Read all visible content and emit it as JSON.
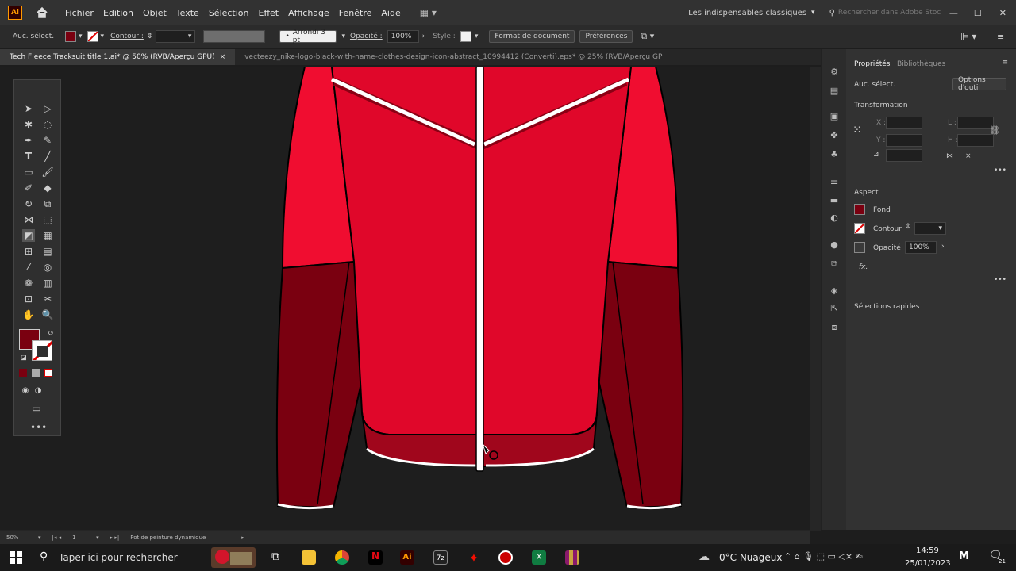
{
  "menubar": {
    "logo": "Ai",
    "items": [
      "Fichier",
      "Edition",
      "Objet",
      "Texte",
      "Sélection",
      "Effet",
      "Affichage",
      "Fenêtre",
      "Aide"
    ],
    "workspace": "Les indispensables classiques",
    "search_placeholder": "Rechercher dans Adobe Stoc"
  },
  "controlbar": {
    "selection": "Auc. sélect.",
    "stroke_label": "Contour :",
    "brush": "Arrondi 3 pt",
    "opacity_label": "Opacité :",
    "opacity_value": "100%",
    "style_label": "Style :",
    "doc_format_button": "Format de document",
    "prefs_button": "Préférences",
    "fill_color": "#7a0010"
  },
  "tabs": [
    {
      "label": "Tech Fleece Tracksuit title 1.ai* @ 50% (RVB/Aperçu GPU)",
      "close": "×"
    },
    {
      "label": "vecteezy_nike-logo-black-with-name-clothes-design-icon-abstract_10994412 (Converti).eps* @ 25% (RVB/Aperçu GP",
      "close": ""
    }
  ],
  "panel": {
    "tab_properties": "Propriétés",
    "tab_libraries": "Bibliothèques",
    "selection": "Auc. sélect.",
    "tool_options_button": "Options d'outil",
    "transform_title": "Transformation",
    "x_label": "X :",
    "y_label": "Y :",
    "w_label": "L :",
    "h_label": "H :",
    "aspect_title": "Aspect",
    "fill_label": "Fond",
    "stroke_label": "Contour",
    "opacity_label": "Opacité",
    "opacity_value": "100%",
    "fx_label": "fx.",
    "quick_actions": "Sélections rapides"
  },
  "statusbar": {
    "zoom": "50%",
    "page": "1",
    "tool": "Pot de peinture dynamique"
  },
  "taskbar": {
    "search_placeholder": "Taper ici pour rechercher",
    "weather": "0°C  Nuageux",
    "time": "14:59",
    "date": "25/01/2023",
    "notif_count": "21"
  },
  "colors": {
    "jacket_main": "#e0072a",
    "jacket_upper_sleeve": "#f00d30",
    "jacket_dark": "#7a0010",
    "hem_dark": "#a0061c",
    "accent": "#ff9a00"
  }
}
